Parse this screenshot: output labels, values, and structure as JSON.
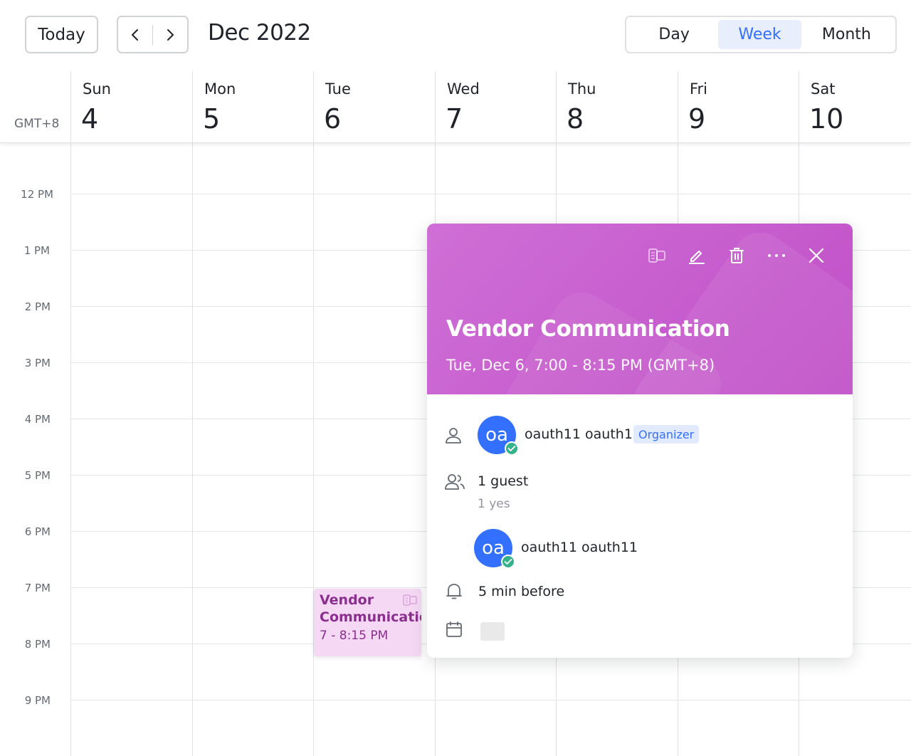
{
  "toolbar": {
    "today_label": "Today",
    "month_title": "Dec 2022",
    "views": {
      "day": "Day",
      "week": "Week",
      "month": "Month"
    },
    "active_view": "Week"
  },
  "week": {
    "timezone": "GMT+8",
    "days": [
      {
        "name": "Sun",
        "num": "4"
      },
      {
        "name": "Mon",
        "num": "5"
      },
      {
        "name": "Tue",
        "num": "6"
      },
      {
        "name": "Wed",
        "num": "7"
      },
      {
        "name": "Thu",
        "num": "8"
      },
      {
        "name": "Fri",
        "num": "9"
      },
      {
        "name": "Sat",
        "num": "10"
      }
    ]
  },
  "times": [
    "12 PM",
    "1 PM",
    "2 PM",
    "3 PM",
    "4 PM",
    "5 PM",
    "6 PM",
    "7 PM",
    "8 PM",
    "9 PM"
  ],
  "event": {
    "title": "Vendor Communication",
    "time": "7 - 8:15 PM"
  },
  "popup": {
    "title": "Vendor Communication",
    "date": "Tue, Dec 6, 7:00 - 8:15 PM (GMT+8)",
    "organizer": {
      "initials": "oa",
      "name": "oauth11 oauth11",
      "badge": "Organizer"
    },
    "guests_count": "1 guest",
    "guests_summary": "1 yes",
    "guest": {
      "initials": "oa",
      "name": "oauth11 oauth11"
    },
    "reminder": "5 min before"
  },
  "colors": {
    "accent": "#3370ff",
    "event_bg": "#f4d8f4",
    "event_text": "#8a2f8d",
    "popup_header": "#c85ccf",
    "accepted": "#34b28a"
  }
}
